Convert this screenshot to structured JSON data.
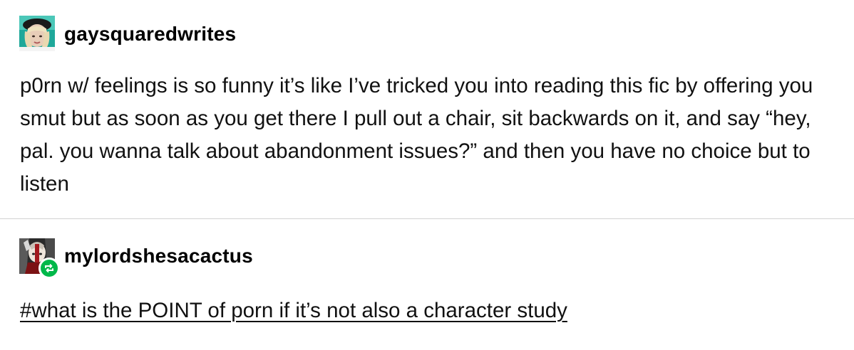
{
  "posts": [
    {
      "username": "gaysquaredwrites",
      "body": "p0rn w/ feelings is so funny it’s like I’ve tricked you into reading this fic by offering you smut but as soon as you get there I pull out a chair, sit backwards on it, and say “hey, pal. you wanna talk about abandonment issues?” and then you have no choice but to listen"
    },
    {
      "username": "mylordshesacactus",
      "reblog_icon": "reblog-icon",
      "tag": "#what is the POINT of porn if it’s not also a character study"
    }
  ],
  "colors": {
    "reblog_green": "#00b84a",
    "divider": "#d2d2d2"
  }
}
